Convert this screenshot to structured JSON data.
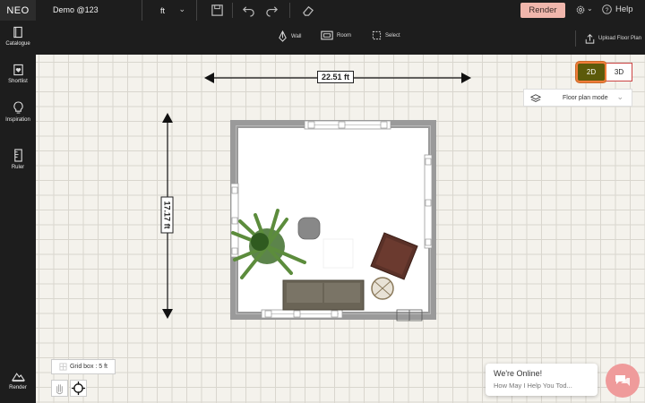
{
  "topbar": {
    "logo": "NEO",
    "project_name": "Demo @123",
    "unit": "ft",
    "render_label": "Render",
    "help_label": "Help"
  },
  "toolbar": {
    "wall_label": "Wall",
    "room_label": "Room",
    "select_label": "Select",
    "upload_label": "Upload Floor Plan"
  },
  "sidebar": {
    "items": [
      {
        "label": "Catalogue",
        "icon": "catalogue-icon"
      },
      {
        "label": "Shortlist",
        "icon": "shortlist-icon"
      },
      {
        "label": "Inspiration",
        "icon": "bulb-icon"
      },
      {
        "label": "Ruler",
        "icon": "ruler-icon"
      },
      {
        "label": "Render",
        "icon": "render-icon"
      }
    ]
  },
  "canvas": {
    "width_dimension": "22.51 ft",
    "height_dimension": "17.17 ft",
    "view_2d": "2D",
    "view_3d": "3D",
    "floor_plan_mode": "Floor plan mode",
    "grid_box": "Grid box : 5 ft"
  },
  "chat": {
    "title": "We're Online!",
    "subtitle": "How May I Help You Tod..."
  },
  "colors": {
    "accent": "#f0b6ac",
    "active_2d": "#5c5a0a",
    "highlight": "#f07c3a"
  }
}
